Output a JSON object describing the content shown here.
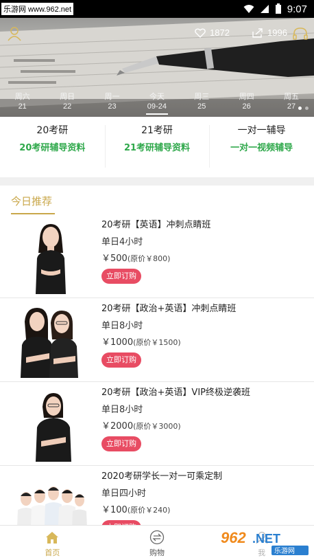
{
  "status_bar": {
    "watermark": "乐游网 www.962.net",
    "time": "9:07"
  },
  "banner": {
    "likes": "1872",
    "shares": "1996",
    "dates": [
      {
        "weekday": "周六",
        "day": "21"
      },
      {
        "weekday": "周日",
        "day": "22"
      },
      {
        "weekday": "周一",
        "day": "23"
      },
      {
        "weekday": "今天",
        "day": "09-24"
      },
      {
        "weekday": "周三",
        "day": "25"
      },
      {
        "weekday": "周四",
        "day": "26"
      },
      {
        "weekday": "周五",
        "day": "27"
      }
    ],
    "active_date_index": 3
  },
  "categories": [
    {
      "title": "20考研",
      "subtitle": "20考研辅导资料"
    },
    {
      "title": "21考研",
      "subtitle": "21考研辅导资料"
    },
    {
      "title": "一对一辅导",
      "subtitle": "一对一视频辅导"
    }
  ],
  "recommend": {
    "title": "今日推荐",
    "courses": [
      {
        "name": "20考研【英语】冲刺点睛班",
        "hours": "单日4小时",
        "price": "￥500",
        "original": "(原价￥800)",
        "button": "立即订购"
      },
      {
        "name": "20考研【政治+英语】冲刺点睛班",
        "hours": "单日8小时",
        "price": "￥1000",
        "original": "(原价￥1500)",
        "button": "立即订购"
      },
      {
        "name": "20考研【政治+英语】VIP终极逆袭班",
        "hours": "单日8小时",
        "price": "￥2000",
        "original": "(原价￥3000)",
        "button": "立即订购"
      },
      {
        "name": "2020考研学长一对一可乘定制",
        "hours": "单日四小时",
        "price": "￥100",
        "original": "(原价￥240)",
        "button": "立即订购"
      }
    ]
  },
  "bottom_nav": [
    {
      "label": "首页",
      "icon": "home-icon",
      "active": true
    },
    {
      "label": "购物",
      "icon": "exchange-icon",
      "active": false
    },
    {
      "label": "我",
      "icon": "profile-icon",
      "active": false
    }
  ],
  "watermark_logo": "962.NET 乐游网",
  "colors": {
    "accent_gold": "#c9a74a",
    "green": "#2ea84a",
    "button_pink": "#e84c63"
  }
}
